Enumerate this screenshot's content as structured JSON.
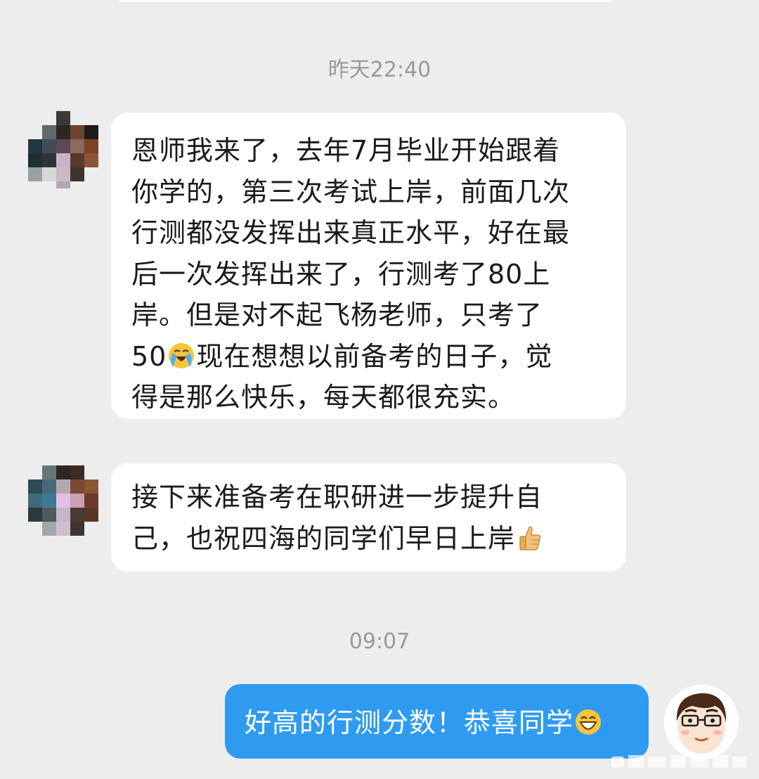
{
  "chat": {
    "timestamp_1": "昨天22:40",
    "timestamp_2": "09:07",
    "messages": [
      {
        "lines": [
          "恩师我来了，去年7月毕业开始跟着",
          "你学的，第三次考试上岸，前面几次",
          "行测都没发挥出来真正水平，好在最",
          "后一次发挥出来了，行测考了80上",
          "岸。但是对不起飞杨老师，只考了"
        ],
        "line6_before": "50",
        "line6_emoji": "loudly-crying-face-icon",
        "line6_after": "现在想想以前备考的日子，觉",
        "line7": "得是那么快乐，每天都很充实。"
      },
      {
        "line1": "接下来准备考在职研进一步提升自",
        "line2": "己，也祝四海的同学们早日上岸",
        "emoji": "thumbs-up-icon"
      }
    ],
    "reply": {
      "text": "好高的行测分数！恭喜同学",
      "emoji": "grinning-face-icon"
    }
  },
  "colors": {
    "background": "#ededee",
    "incoming_bubble": "#ffffff",
    "outgoing_bubble": "#2f9bf0",
    "timestamp_text": "#9a9a9a"
  }
}
